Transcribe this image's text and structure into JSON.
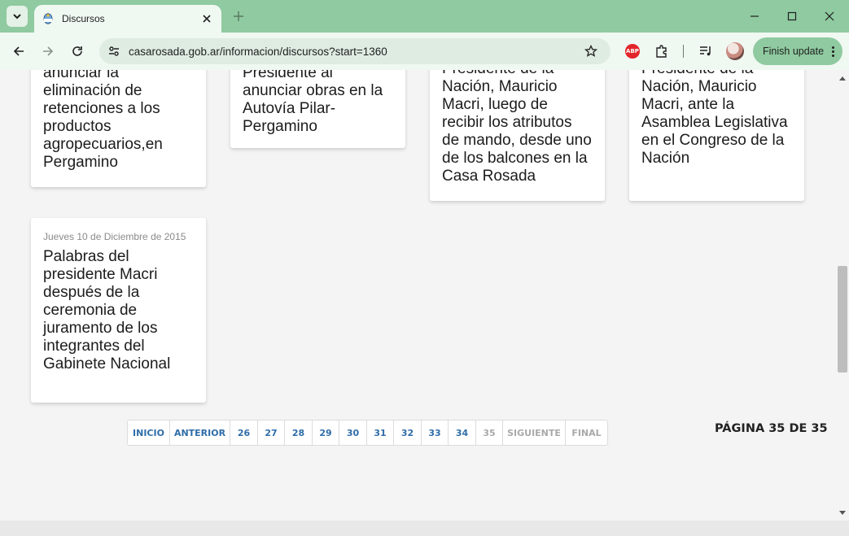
{
  "browser": {
    "tab": {
      "title": "Discursos",
      "favicon": "argentina-coat-of-arms-icon"
    },
    "url": "casarosada.gob.ar/informacion/discursos?start=1360",
    "finish_update": "Finish update",
    "abp_label": "ABP"
  },
  "cards": [
    {
      "date": "",
      "title": "anunciar la eliminación de retenciones a los productos agropecuarios,en Pergamino"
    },
    {
      "date": "",
      "title": "Presidente al anunciar obras en la Autovía Pilar-Pergamino"
    },
    {
      "date": "",
      "title": "Presidente de la Nación, Mauricio Macri, luego de recibir los atributos de mando, desde uno de los balcones en la Casa Rosada"
    },
    {
      "date": "",
      "title": "Presidente de la Nación, Mauricio Macri, ante la Asamblea Legislativa en el Congreso de la Nación"
    },
    {
      "date": "Jueves 10 de Diciembre de 2015",
      "title": "Palabras del presidente Macri después de la ceremonia de juramento de los integrantes del Gabinete Nacional"
    }
  ],
  "pagination": {
    "items": [
      "INICIO",
      "ANTERIOR",
      "26",
      "27",
      "28",
      "29",
      "30",
      "31",
      "32",
      "33",
      "34",
      "35",
      "SIGUIENTE",
      "FINAL"
    ],
    "current": "35",
    "counter": "PÁGINA 35 DE 35"
  },
  "colors": {
    "frame": "#8fcaa0",
    "toolbar": "#f0f8f2",
    "link": "#2f6da8",
    "disabled": "#a9a9a9"
  }
}
